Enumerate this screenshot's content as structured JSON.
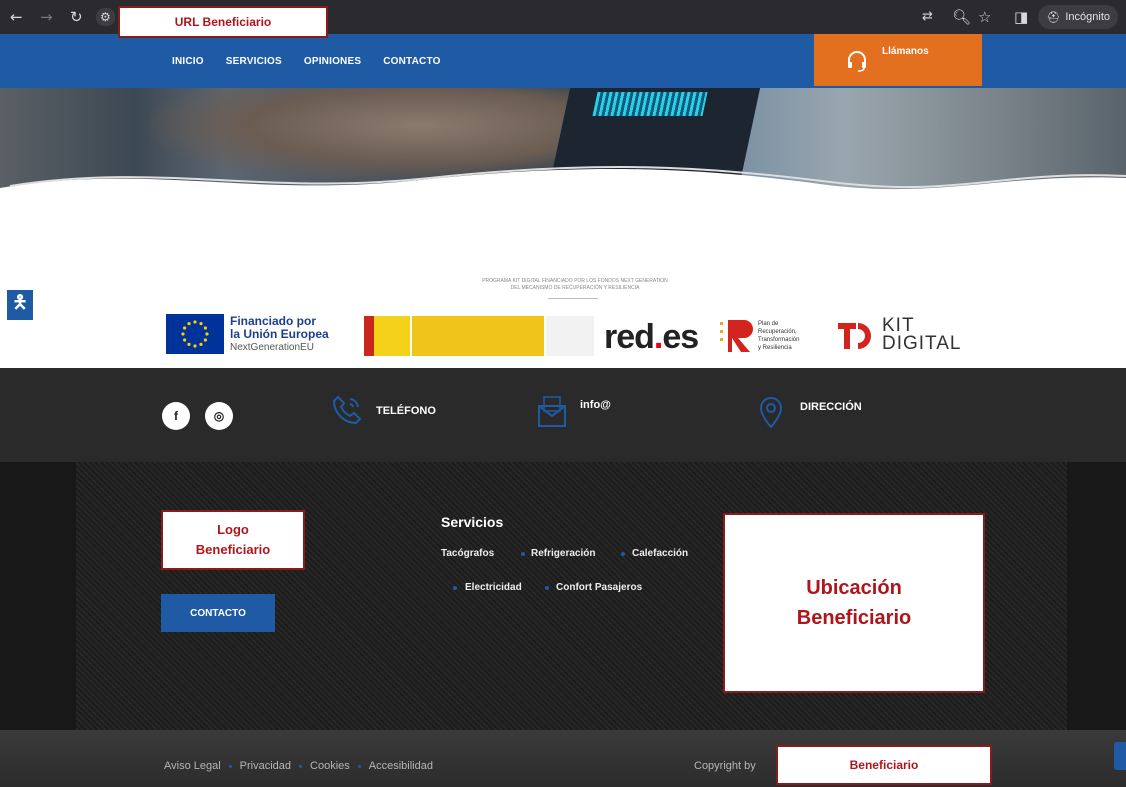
{
  "browser": {
    "url_label": "URL Beneficiario",
    "incognito_label": "Incógnito"
  },
  "nav": {
    "items": [
      "INICIO",
      "SERVICIOS",
      "OPINIONES",
      "CONTACTO"
    ],
    "call_label": "Llámanos"
  },
  "funding": {
    "note_line1": "PROGRAMA KIT DIGITAL FINANCIADO POR LOS FONDOS NEXT GENERATION",
    "note_line2": "DEL MECANISMO DE RECUPERACIÓN Y RESILIENCIA",
    "eu_line1": "Financiado por",
    "eu_line2": "la Unión Europea",
    "eu_line3": "NextGenerationEU",
    "redes_main": "red",
    "redes_dot": ".",
    "redes_end": "es",
    "prtr_line1": "Plan de",
    "prtr_line2": "Recuperación,",
    "prtr_line3": "Transformación",
    "prtr_line4": "y Resiliencia",
    "kit_line1": "KIT",
    "kit_line2": "DIGITAL"
  },
  "info": {
    "phone_label": "TELÉFONO",
    "email_label": "info@",
    "address_label": "DIRECCIÓN"
  },
  "footer": {
    "logo_line1": "Logo",
    "logo_line2": "Beneficiario",
    "contact_button": "CONTACTO",
    "services_title": "Servicios",
    "services": [
      "Tacógrafos",
      "Refrigeración",
      "Calefacción",
      "Electricidad",
      "Confort Pasajeros"
    ],
    "location_line1": "Ubicación",
    "location_line2": "Beneficiario"
  },
  "bottom": {
    "links": [
      "Aviso Legal",
      "Privacidad",
      "Cookies",
      "Accesibilidad"
    ],
    "copyright": "Copyright by",
    "beneficiary": "Beneficiario"
  },
  "colors": {
    "primary_blue": "#1f5aa5",
    "orange": "#e3701f",
    "annotation_red": "#b0151c"
  }
}
